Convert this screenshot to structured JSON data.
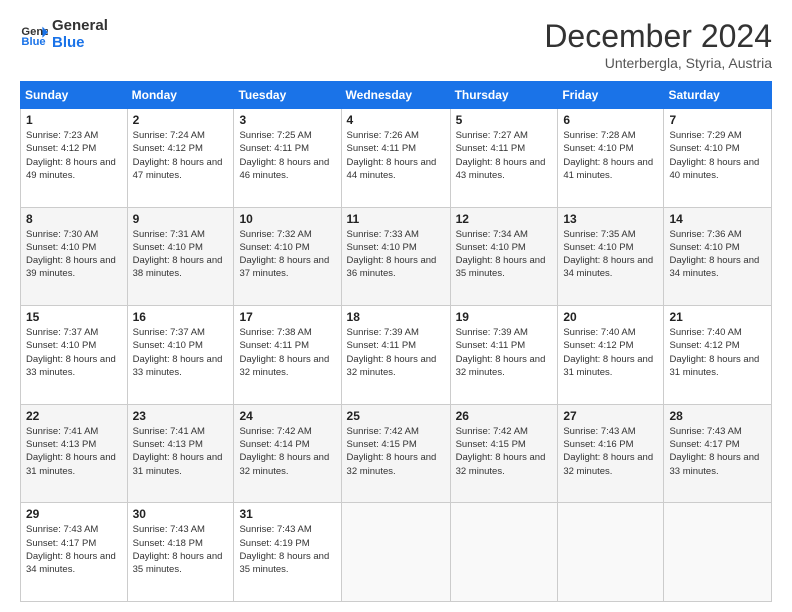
{
  "logo": {
    "line1": "General",
    "line2": "Blue"
  },
  "header": {
    "month": "December 2024",
    "location": "Unterbergla, Styria, Austria"
  },
  "weekdays": [
    "Sunday",
    "Monday",
    "Tuesday",
    "Wednesday",
    "Thursday",
    "Friday",
    "Saturday"
  ],
  "weeks": [
    [
      {
        "day": "1",
        "sunrise": "Sunrise: 7:23 AM",
        "sunset": "Sunset: 4:12 PM",
        "daylight": "Daylight: 8 hours and 49 minutes."
      },
      {
        "day": "2",
        "sunrise": "Sunrise: 7:24 AM",
        "sunset": "Sunset: 4:12 PM",
        "daylight": "Daylight: 8 hours and 47 minutes."
      },
      {
        "day": "3",
        "sunrise": "Sunrise: 7:25 AM",
        "sunset": "Sunset: 4:11 PM",
        "daylight": "Daylight: 8 hours and 46 minutes."
      },
      {
        "day": "4",
        "sunrise": "Sunrise: 7:26 AM",
        "sunset": "Sunset: 4:11 PM",
        "daylight": "Daylight: 8 hours and 44 minutes."
      },
      {
        "day": "5",
        "sunrise": "Sunrise: 7:27 AM",
        "sunset": "Sunset: 4:11 PM",
        "daylight": "Daylight: 8 hours and 43 minutes."
      },
      {
        "day": "6",
        "sunrise": "Sunrise: 7:28 AM",
        "sunset": "Sunset: 4:10 PM",
        "daylight": "Daylight: 8 hours and 41 minutes."
      },
      {
        "day": "7",
        "sunrise": "Sunrise: 7:29 AM",
        "sunset": "Sunset: 4:10 PM",
        "daylight": "Daylight: 8 hours and 40 minutes."
      }
    ],
    [
      {
        "day": "8",
        "sunrise": "Sunrise: 7:30 AM",
        "sunset": "Sunset: 4:10 PM",
        "daylight": "Daylight: 8 hours and 39 minutes."
      },
      {
        "day": "9",
        "sunrise": "Sunrise: 7:31 AM",
        "sunset": "Sunset: 4:10 PM",
        "daylight": "Daylight: 8 hours and 38 minutes."
      },
      {
        "day": "10",
        "sunrise": "Sunrise: 7:32 AM",
        "sunset": "Sunset: 4:10 PM",
        "daylight": "Daylight: 8 hours and 37 minutes."
      },
      {
        "day": "11",
        "sunrise": "Sunrise: 7:33 AM",
        "sunset": "Sunset: 4:10 PM",
        "daylight": "Daylight: 8 hours and 36 minutes."
      },
      {
        "day": "12",
        "sunrise": "Sunrise: 7:34 AM",
        "sunset": "Sunset: 4:10 PM",
        "daylight": "Daylight: 8 hours and 35 minutes."
      },
      {
        "day": "13",
        "sunrise": "Sunrise: 7:35 AM",
        "sunset": "Sunset: 4:10 PM",
        "daylight": "Daylight: 8 hours and 34 minutes."
      },
      {
        "day": "14",
        "sunrise": "Sunrise: 7:36 AM",
        "sunset": "Sunset: 4:10 PM",
        "daylight": "Daylight: 8 hours and 34 minutes."
      }
    ],
    [
      {
        "day": "15",
        "sunrise": "Sunrise: 7:37 AM",
        "sunset": "Sunset: 4:10 PM",
        "daylight": "Daylight: 8 hours and 33 minutes."
      },
      {
        "day": "16",
        "sunrise": "Sunrise: 7:37 AM",
        "sunset": "Sunset: 4:10 PM",
        "daylight": "Daylight: 8 hours and 33 minutes."
      },
      {
        "day": "17",
        "sunrise": "Sunrise: 7:38 AM",
        "sunset": "Sunset: 4:11 PM",
        "daylight": "Daylight: 8 hours and 32 minutes."
      },
      {
        "day": "18",
        "sunrise": "Sunrise: 7:39 AM",
        "sunset": "Sunset: 4:11 PM",
        "daylight": "Daylight: 8 hours and 32 minutes."
      },
      {
        "day": "19",
        "sunrise": "Sunrise: 7:39 AM",
        "sunset": "Sunset: 4:11 PM",
        "daylight": "Daylight: 8 hours and 32 minutes."
      },
      {
        "day": "20",
        "sunrise": "Sunrise: 7:40 AM",
        "sunset": "Sunset: 4:12 PM",
        "daylight": "Daylight: 8 hours and 31 minutes."
      },
      {
        "day": "21",
        "sunrise": "Sunrise: 7:40 AM",
        "sunset": "Sunset: 4:12 PM",
        "daylight": "Daylight: 8 hours and 31 minutes."
      }
    ],
    [
      {
        "day": "22",
        "sunrise": "Sunrise: 7:41 AM",
        "sunset": "Sunset: 4:13 PM",
        "daylight": "Daylight: 8 hours and 31 minutes."
      },
      {
        "day": "23",
        "sunrise": "Sunrise: 7:41 AM",
        "sunset": "Sunset: 4:13 PM",
        "daylight": "Daylight: 8 hours and 31 minutes."
      },
      {
        "day": "24",
        "sunrise": "Sunrise: 7:42 AM",
        "sunset": "Sunset: 4:14 PM",
        "daylight": "Daylight: 8 hours and 32 minutes."
      },
      {
        "day": "25",
        "sunrise": "Sunrise: 7:42 AM",
        "sunset": "Sunset: 4:15 PM",
        "daylight": "Daylight: 8 hours and 32 minutes."
      },
      {
        "day": "26",
        "sunrise": "Sunrise: 7:42 AM",
        "sunset": "Sunset: 4:15 PM",
        "daylight": "Daylight: 8 hours and 32 minutes."
      },
      {
        "day": "27",
        "sunrise": "Sunrise: 7:43 AM",
        "sunset": "Sunset: 4:16 PM",
        "daylight": "Daylight: 8 hours and 32 minutes."
      },
      {
        "day": "28",
        "sunrise": "Sunrise: 7:43 AM",
        "sunset": "Sunset: 4:17 PM",
        "daylight": "Daylight: 8 hours and 33 minutes."
      }
    ],
    [
      {
        "day": "29",
        "sunrise": "Sunrise: 7:43 AM",
        "sunset": "Sunset: 4:17 PM",
        "daylight": "Daylight: 8 hours and 34 minutes."
      },
      {
        "day": "30",
        "sunrise": "Sunrise: 7:43 AM",
        "sunset": "Sunset: 4:18 PM",
        "daylight": "Daylight: 8 hours and 35 minutes."
      },
      {
        "day": "31",
        "sunrise": "Sunrise: 7:43 AM",
        "sunset": "Sunset: 4:19 PM",
        "daylight": "Daylight: 8 hours and 35 minutes."
      },
      null,
      null,
      null,
      null
    ]
  ]
}
